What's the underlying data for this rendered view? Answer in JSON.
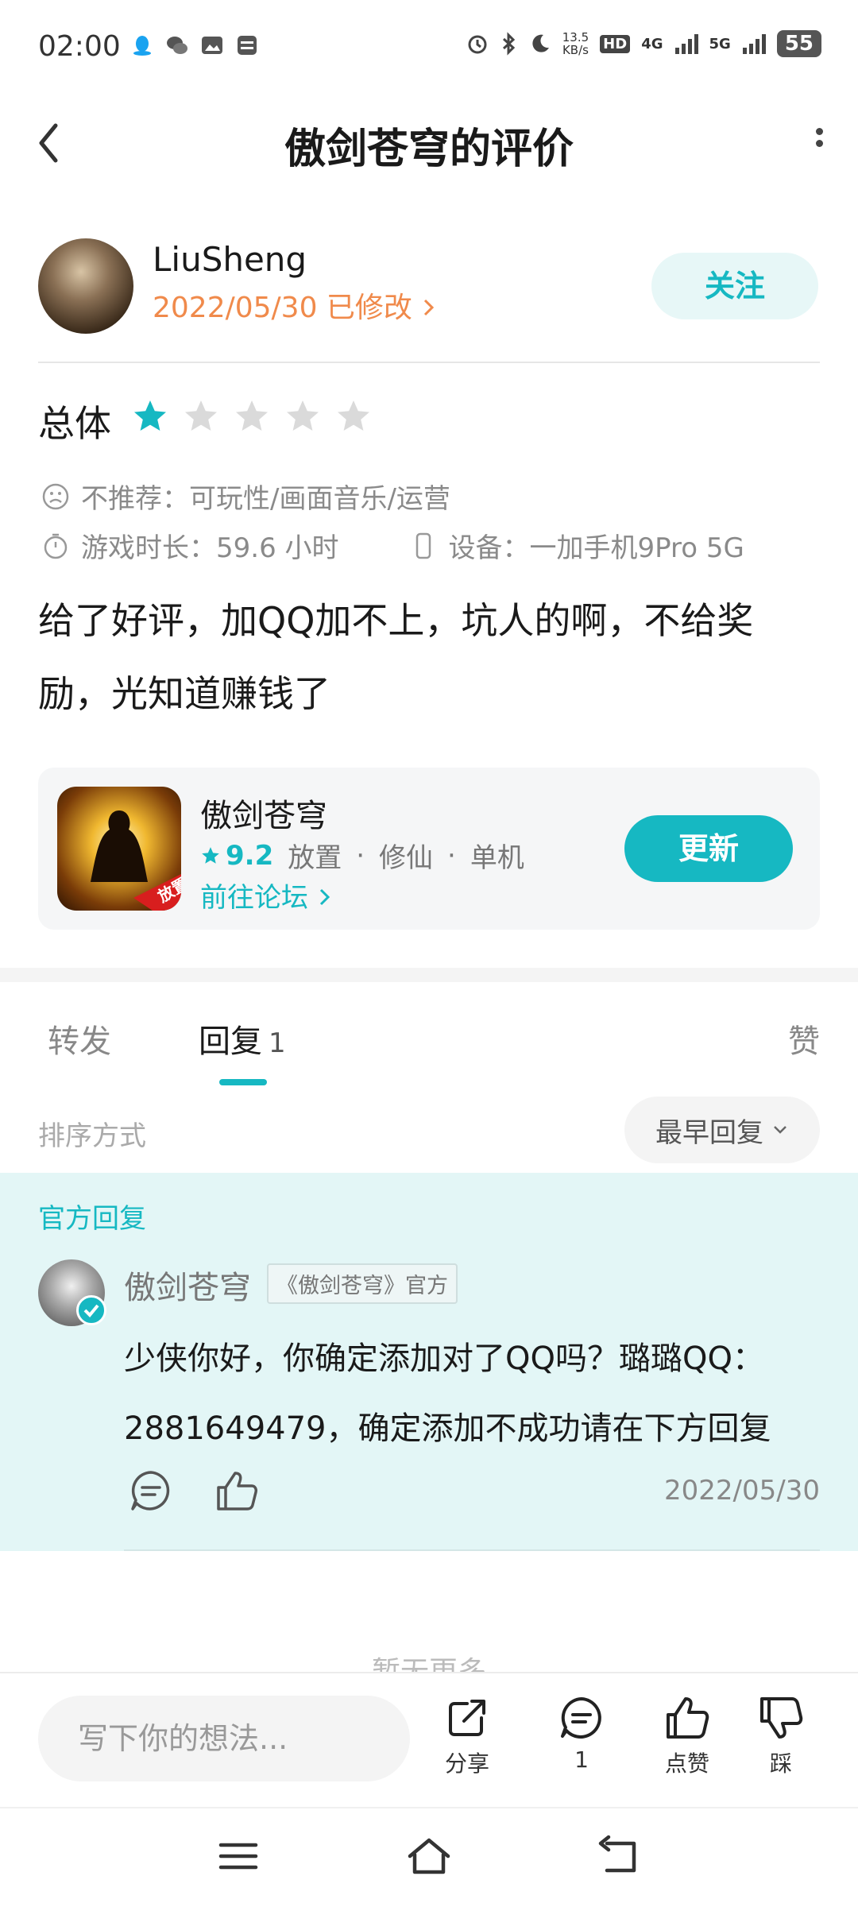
{
  "status_bar": {
    "time": "02:00",
    "net_speed": "13.5",
    "net_speed_unit": "KB/s",
    "hd_label": "HD",
    "network_4g": "4G",
    "network_5g": "5G",
    "battery": "55"
  },
  "header": {
    "title": "傲剑苍穹的评价"
  },
  "review": {
    "username": "LiuSheng",
    "date": "2022/05/30 已修改",
    "follow_label": "关注",
    "overall_label": "总体",
    "rating_stars": 1,
    "rating_max": 5,
    "not_recommend": "不推荐：可玩性/画面音乐/运营",
    "playtime": "游戏时长：59.6 小时",
    "device": "设备：一加手机9Pro 5G",
    "text": "给了好评，加QQ加不上，坑人的啊，不给奖励，光知道赚钱了"
  },
  "game_card": {
    "name": "傲剑苍穹",
    "rating": "9.2",
    "tags": [
      "放置",
      "修仙",
      "单机"
    ],
    "forum_link": "前往论坛",
    "update_label": "更新",
    "icon_badge": "放置"
  },
  "tabs": {
    "forward": "转发",
    "reply": "回复",
    "reply_count": "1",
    "like": "赞"
  },
  "sort": {
    "label": "排序方式",
    "selected": "最早回复"
  },
  "official_reply": {
    "section_label": "官方回复",
    "author": "傲剑苍穹",
    "tag": "《傲剑苍穹》官方",
    "text": "少侠你好，你确定添加对了QQ吗？璐璐QQ：2881649479，确定添加不成功请在下方回复",
    "date": "2022/05/30"
  },
  "no_more": "暂无更多",
  "bottom_bar": {
    "input_placeholder": "写下你的想法...",
    "share_label": "分享",
    "comment_count": "1",
    "like_label": "点赞",
    "dislike_label": "踩"
  },
  "colors": {
    "accent": "#16b8c2",
    "date_orange": "#f08a4b",
    "official_bg": "#e3f6f6"
  }
}
